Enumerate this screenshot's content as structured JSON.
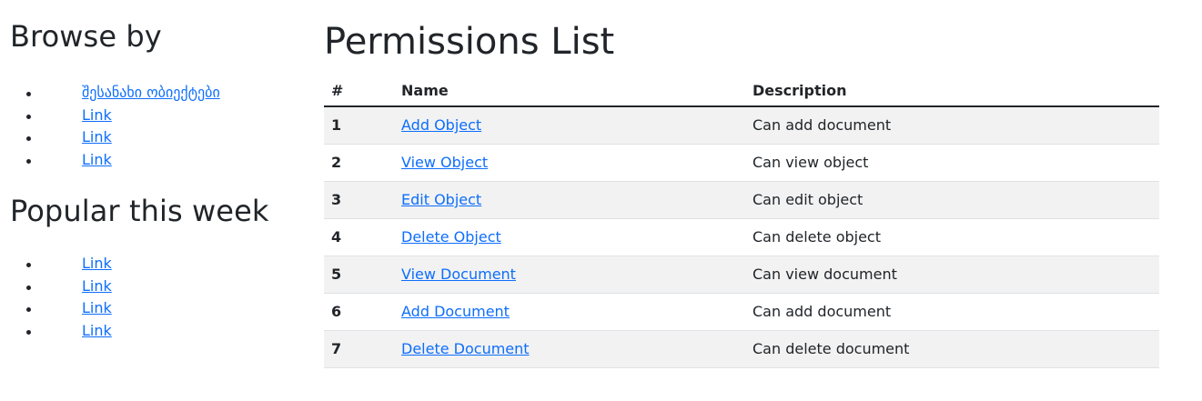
{
  "sidebar": {
    "browse_title": "Browse by",
    "browse_links": [
      "შესანახი ობიექტები",
      "Link",
      "Link",
      "Link"
    ],
    "popular_title": "Popular this week",
    "popular_links": [
      "Link",
      "Link",
      "Link",
      "Link"
    ]
  },
  "main": {
    "title": "Permissions List",
    "table": {
      "headers": [
        "#",
        "Name",
        "Description"
      ],
      "rows": [
        {
          "num": "1",
          "name": "Add Object",
          "description": "Can add document"
        },
        {
          "num": "2",
          "name": "View Object",
          "description": "Can view object"
        },
        {
          "num": "3",
          "name": "Edit Object",
          "description": "Can edit object"
        },
        {
          "num": "4",
          "name": "Delete Object",
          "description": "Can delete object"
        },
        {
          "num": "5",
          "name": "View Document",
          "description": "Can view document"
        },
        {
          "num": "6",
          "name": "Add Document",
          "description": "Can add document"
        },
        {
          "num": "7",
          "name": "Delete Document",
          "description": "Can delete document"
        }
      ]
    }
  },
  "colors": {
    "link": "#0d6efd",
    "text": "#212529",
    "stripe": "#f2f2f2",
    "row_border": "#dee2e6"
  }
}
